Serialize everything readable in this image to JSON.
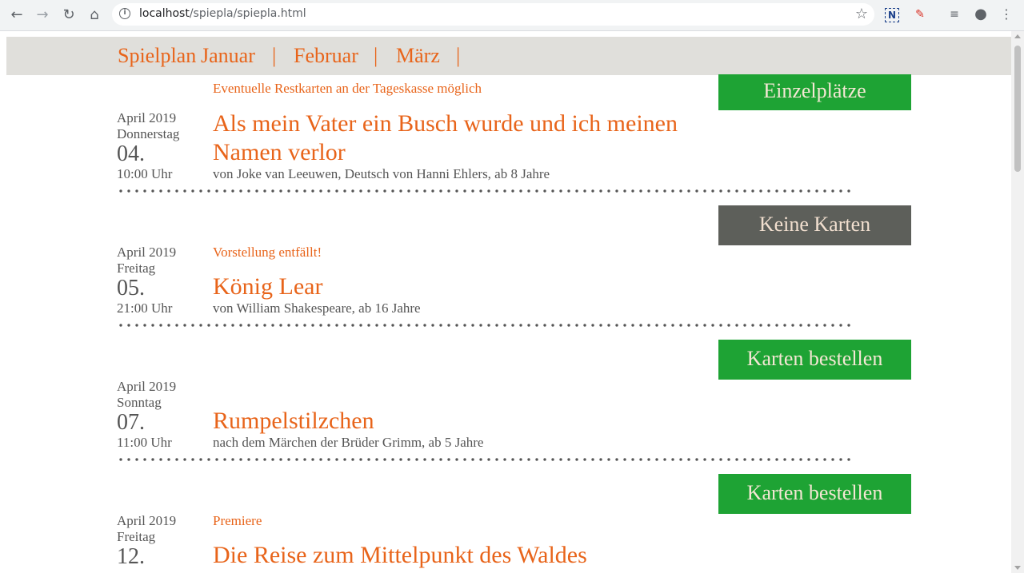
{
  "browser": {
    "url_host": "localhost",
    "url_path": "/spiepla/spiepla.html"
  },
  "nav": {
    "items": [
      "Spielplan",
      "Januar",
      "Februar",
      "März"
    ],
    "separator": "|"
  },
  "events": [
    {
      "note": "Eventuelle Restkarten an der Tageskasse möglich",
      "button": "Einzelplätze",
      "month": "April 2019",
      "weekday": "Donnerstag",
      "day": "04.",
      "time": "10:00 Uhr",
      "title": "Als mein Vater ein Busch wurde und ich meinen Namen verlor",
      "byline": "von Joke van Leeuwen, Deutsch von Hanni Ehlers, ab 8 Jahre"
    },
    {
      "note": "Vorstellung entfällt!",
      "button": "Keine Karten",
      "month": "April 2019",
      "weekday": "Freitag",
      "day": "05.",
      "time": "21:00 Uhr",
      "title": "König Lear",
      "byline": "von William Shakespeare, ab 16 Jahre"
    },
    {
      "note": "",
      "button": "Karten bestellen",
      "month": "April 2019",
      "weekday": "Sonntag",
      "day": "07.",
      "time": "11:00 Uhr",
      "title": "Rumpelstilzchen",
      "byline": "nach dem Märchen der Brüder Grimm, ab 5 Jahre"
    },
    {
      "note": "Premiere",
      "button": "Karten bestellen",
      "month": "April 2019",
      "weekday": "Freitag",
      "day": "12.",
      "time": "",
      "title": "Die Reise zum Mittelpunkt des Waldes",
      "byline": ""
    }
  ],
  "colors": {
    "accent": "#e8641a",
    "button_green": "#1ea334",
    "button_grey": "#5d5f5a",
    "nav_bg": "#e0dfdb",
    "text": "#555555"
  }
}
